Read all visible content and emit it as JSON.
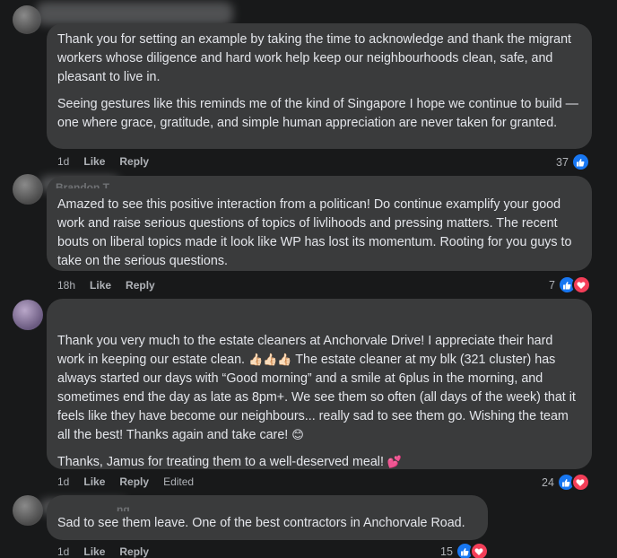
{
  "comments": [
    {
      "paragraphs": [
        "Thank you for setting an example by taking the time to acknowledge and thank the migrant workers whose diligence and hard work help keep our neighbourhoods clean, safe, and pleasant to live in.",
        "Seeing gestures like this reminds me of the kind of Singapore I hope we continue to build — one where grace, gratitude, and simple human appreciation are never taken for granted."
      ],
      "time": "1d",
      "like": "Like",
      "reply": "Reply",
      "reaction_count": "37"
    },
    {
      "author_partial": "Brandon T",
      "paragraphs": [
        "Amazed to see this positive interaction from a politican! Do continue examplify your good work and raise serious questions of topics of livlihoods and pressing matters. The recent bouts on liberal topics made it look like WP has lost its momentum. Rooting for you guys to take on the serious questions."
      ],
      "time": "18h",
      "like": "Like",
      "reply": "Reply",
      "reaction_count": "7"
    },
    {
      "paragraph_1_a": "Thank you very much to the estate cleaners at Anchorvale Drive! I appreciate their hard work in keeping our estate clean. ",
      "paragraph_1_emoji": "👍🏻👍🏻👍🏻",
      "paragraph_1_b": " The estate cleaner at my blk (321 cluster) has always started our days with “Good morning” and a smile at 6plus in the morning, and sometimes end the day as late as 8pm+. We see them so often (all days of the week) that it feels like they have become our neighbours... really sad to see them go. Wishing the team all the best! Thanks again and take care! ",
      "paragraph_1_emoji_end": "😊",
      "paragraph_2": "Thanks, Jamus for treating them to a well-deserved meal! ",
      "paragraph_2_emoji": "💕",
      "time": "1d",
      "like": "Like",
      "reply": "Reply",
      "edited": "Edited",
      "reaction_count": "24"
    },
    {
      "author_partial": "ng",
      "paragraphs": [
        "Sad to see them leave. One of the best contractors in Anchorvale Road."
      ],
      "time": "1d",
      "like": "Like",
      "reply": "Reply",
      "reaction_count": "15"
    }
  ],
  "icons": {
    "like": "thumbs-up-icon",
    "love": "heart-icon"
  },
  "colors": {
    "background": "#18191a",
    "bubble": "#3a3b3c",
    "text": "#e4e6eb",
    "meta": "#b0b3b8",
    "like_blue": "#1877f2",
    "love_red": "#f33e58"
  }
}
